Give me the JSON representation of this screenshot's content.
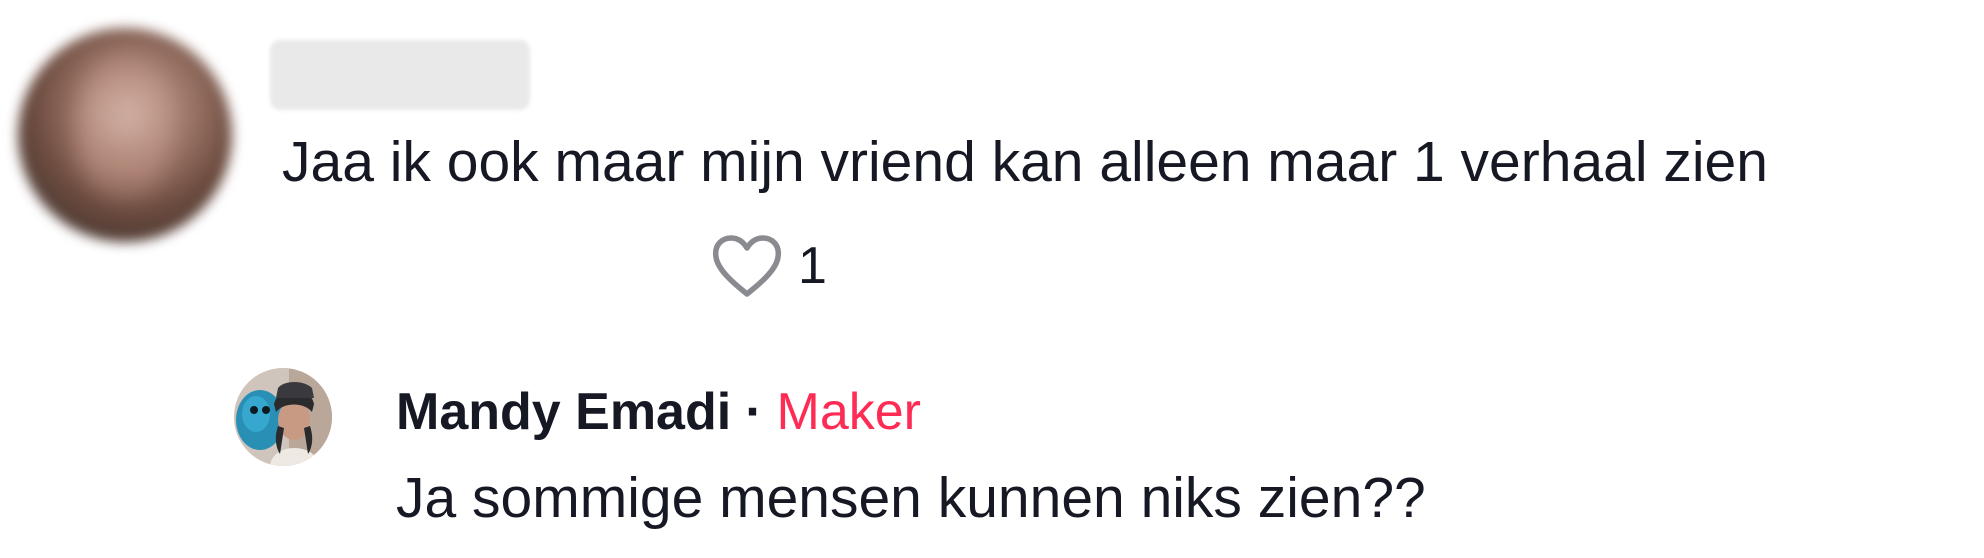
{
  "comment": {
    "username": "",
    "text": "Jaa ik ook maar mijn vriend kan alleen maar 1 verhaal zien",
    "likes": "1",
    "like_icon": "heart-outline-icon"
  },
  "reply": {
    "author": "Mandy Emadi",
    "separator": "·",
    "badge": "Maker",
    "text": "Ja sommige mensen kunnen niks zien??",
    "badge_color": "#fe2c55"
  },
  "colors": {
    "text": "#161823",
    "icon": "#8a8b91",
    "accent": "#fe2c55"
  }
}
